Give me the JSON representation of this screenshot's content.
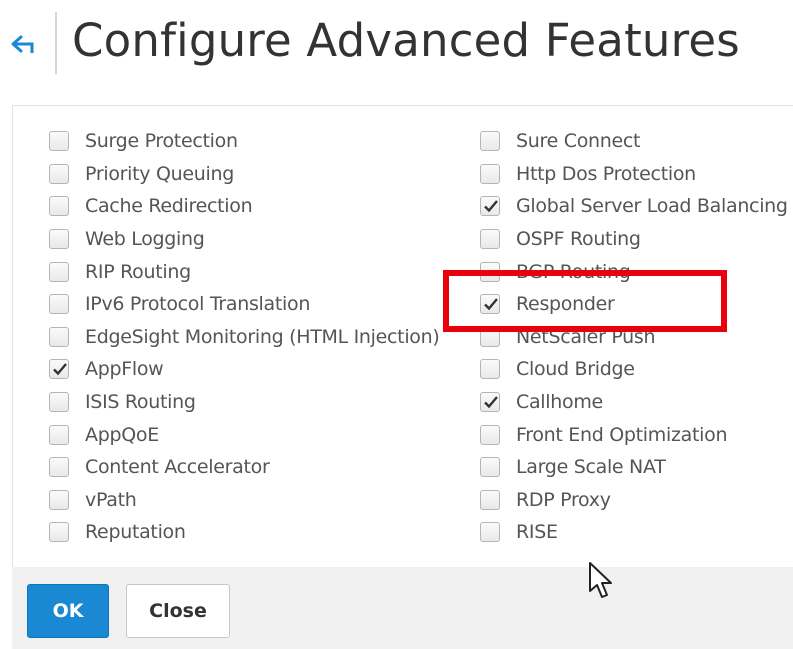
{
  "header": {
    "title": "Configure Advanced Features",
    "back_icon": "back-arrow-icon",
    "accent_color": "#1b88d3"
  },
  "options_left": [
    {
      "label": "Surge Protection",
      "checked": false
    },
    {
      "label": "Priority Queuing",
      "checked": false
    },
    {
      "label": "Cache Redirection",
      "checked": false
    },
    {
      "label": "Web Logging",
      "checked": false
    },
    {
      "label": "RIP Routing",
      "checked": false
    },
    {
      "label": "IPv6 Protocol Translation",
      "checked": false
    },
    {
      "label": "EdgeSight Monitoring (HTML Injection)",
      "checked": false
    },
    {
      "label": "AppFlow",
      "checked": true
    },
    {
      "label": "ISIS Routing",
      "checked": false
    },
    {
      "label": "AppQoE",
      "checked": false
    },
    {
      "label": "Content Accelerator",
      "checked": false
    },
    {
      "label": "vPath",
      "checked": false
    },
    {
      "label": "Reputation",
      "checked": false
    }
  ],
  "options_right": [
    {
      "label": "Sure Connect",
      "checked": false
    },
    {
      "label": "Http Dos Protection",
      "checked": false
    },
    {
      "label": "Global Server Load Balancing",
      "checked": true
    },
    {
      "label": "OSPF Routing",
      "checked": false
    },
    {
      "label": "BGP Routing",
      "checked": false
    },
    {
      "label": "Responder",
      "checked": true
    },
    {
      "label": "NetScaler Push",
      "checked": false
    },
    {
      "label": "Cloud Bridge",
      "checked": false
    },
    {
      "label": "Callhome",
      "checked": true
    },
    {
      "label": "Front End Optimization",
      "checked": false
    },
    {
      "label": "Large Scale NAT",
      "checked": false
    },
    {
      "label": "RDP Proxy",
      "checked": false
    },
    {
      "label": "RISE",
      "checked": false
    }
  ],
  "highlight": {
    "target": "Responder",
    "color": "#e8000b"
  },
  "footer": {
    "ok_label": "OK",
    "close_label": "Close"
  }
}
